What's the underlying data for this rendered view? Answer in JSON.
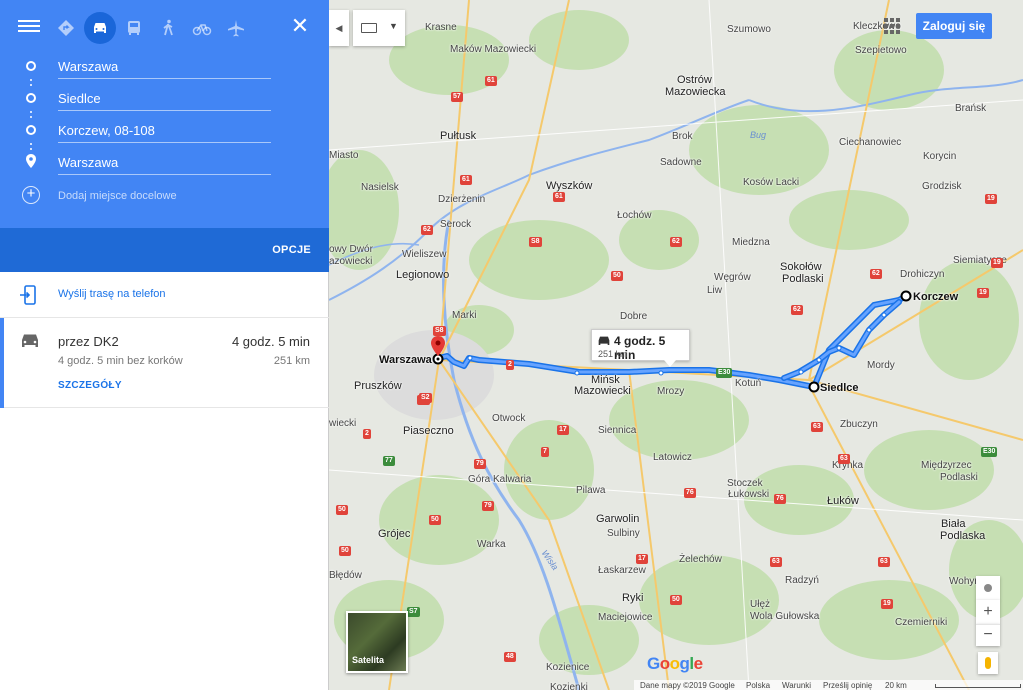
{
  "travel_modes": [
    {
      "name": "best-route",
      "icon": "diamond-route-icon"
    },
    {
      "name": "car",
      "icon": "car-icon",
      "active": true
    },
    {
      "name": "transit",
      "icon": "bus-icon"
    },
    {
      "name": "walk",
      "icon": "walk-icon"
    },
    {
      "name": "bike",
      "icon": "bike-icon"
    },
    {
      "name": "flight",
      "icon": "plane-icon"
    }
  ],
  "waypoints": [
    "Warszawa",
    "Siedlce",
    "Korczew, 08-108",
    "Warszawa"
  ],
  "add_destination_placeholder": "Dodaj miejsce docelowe",
  "options_label": "OPCJE",
  "send_to_phone": "Wyślij trasę na telefon",
  "route": {
    "name": "przez DK2",
    "time": "4 godz. 5 min",
    "traffic": "4 godz. 5 min bez korków",
    "distance": "251 km",
    "details_label": "SZCZEGÓŁY"
  },
  "login_label": "Zaloguj się",
  "route_bubble": {
    "time": "4 godz. 5 min",
    "distance": "251 km"
  },
  "satellite_label": "Satelita",
  "map_places": {
    "warszawa": "Warszawa",
    "siedlce": "Siedlce",
    "korczew": "Korczew",
    "krasne": "Krasne",
    "makow": "Maków Mazowiecki",
    "szumowo": "Szumowo",
    "kleczkowo": "Kleczkowo",
    "szepietowo": "Szepietowo",
    "ostrow1": "Ostrów",
    "ostrow2": "Mazowiecka",
    "pultusk": "Pułtusk",
    "brok": "Brok",
    "bransk": "Brańsk",
    "miasto": "Miasto",
    "sadowne": "Sadowne",
    "ciechanowiec": "Ciechanowiec",
    "korycin": "Korycin",
    "nasielsk": "Nasielsk",
    "wyszkow": "Wyszków",
    "kosow": "Kosów Lacki",
    "grodzisk": "Grodzisk",
    "dzierzenin": "Dzierżenin",
    "lochow": "Łochów",
    "serock": "Serock",
    "wieliszew1": "owy Dwór",
    "wieliszew2": "azowiecki",
    "wieliszew": "Wieliszew",
    "miedzna": "Miedzna",
    "legionowo": "Legionowo",
    "sokolow1": "Sokołów",
    "sokolow2": "Podlaski",
    "wegrow": "Węgrów",
    "liw": "Liw",
    "drohiczyn": "Drohiczyn",
    "siemiatycze": "Siemiatycze",
    "marki": "Marki",
    "dobre": "Dobre",
    "minsk1": "Mińsk",
    "minsk2": "Mazowiecki",
    "mrozy": "Mrozy",
    "kotun": "Kotuń",
    "mordy": "Mordy",
    "pruszkow": "Pruszków",
    "otwock": "Otwock",
    "siennica": "Siennica",
    "zbuczyn": "Zbuczyn",
    "piaseczno": "Piaseczno",
    "wiecki": "wiecki",
    "latowicz": "Latowicz",
    "krynka": "Krynka",
    "gora": "Góra Kalwaria",
    "stoczek1": "Stoczek",
    "stoczek2": "Łukowski",
    "lukow": "Łuków",
    "miedzyrzec1": "Międzyrzec",
    "miedzyrzec2": "Podlaski",
    "pilawa": "Pilawa",
    "garwolin": "Garwolin",
    "sulbiny": "Sulbiny",
    "grojec": "Grójec",
    "warka": "Warka",
    "zelechow": "Żelechów",
    "laskarzew": "Łaskarzew",
    "biala1": "Biała",
    "biala2": "Podlaska",
    "bledow": "Błędów",
    "radzyn": "Radzyń",
    "wohyn": "Wohyń",
    "ryki": "Ryki",
    "ulez": "Ułęż",
    "wola": "Wola Gułowska",
    "maciejowice": "Maciejowice",
    "czemierniki": "Czemierniki",
    "kozienice": "Kozienice",
    "kozienki": "Kozienki",
    "bug": "Bug",
    "wisla": "Wisła"
  },
  "road_labels": [
    "61",
    "57",
    "61",
    "61",
    "62",
    "S8",
    "S8",
    "62",
    "62",
    "50",
    "50",
    "S8",
    "2",
    "S2",
    "E30",
    "63",
    "62",
    "19",
    "19",
    "19",
    "E30",
    "63",
    "79",
    "17",
    "79",
    "7",
    "50",
    "76",
    "76",
    "17",
    "50",
    "48",
    "63",
    "63",
    "19",
    "77",
    "50",
    "2",
    "S7"
  ],
  "footer": {
    "attribution": "Dane mapy ©2019 Google",
    "country": "Polska",
    "terms": "Warunki",
    "feedback": "Prześlij opinię",
    "scale": "20 km"
  },
  "google_logo": [
    "G",
    "o",
    "o",
    "g",
    "l",
    "e"
  ]
}
